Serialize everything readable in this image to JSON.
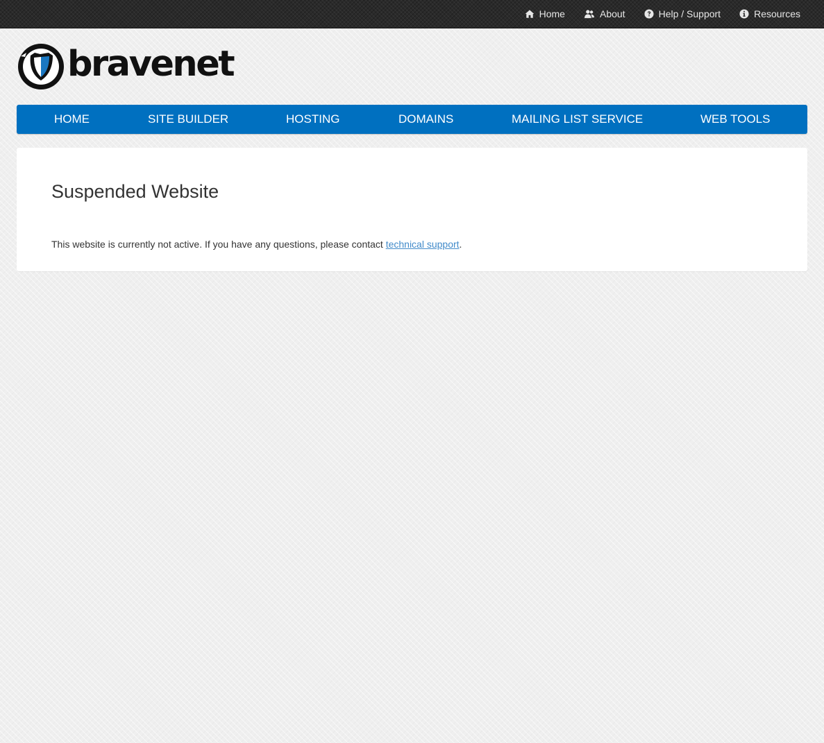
{
  "topnav": {
    "items": [
      {
        "label": "Home",
        "icon": "home-icon"
      },
      {
        "label": "About",
        "icon": "users-icon"
      },
      {
        "label": "Help / Support",
        "icon": "question-circle-icon"
      },
      {
        "label": "Resources",
        "icon": "info-circle-icon"
      }
    ]
  },
  "logo": {
    "text": "bravenet",
    "icon": "shield-logo-icon"
  },
  "mainnav": {
    "items": [
      {
        "label": "HOME"
      },
      {
        "label": "SITE BUILDER"
      },
      {
        "label": "HOSTING"
      },
      {
        "label": "DOMAINS"
      },
      {
        "label": "MAILING LIST SERVICE"
      },
      {
        "label": "WEB TOOLS"
      }
    ]
  },
  "content": {
    "title": "Suspended Website",
    "message_before": "This website is currently not active. If you have any questions, please contact ",
    "link_text": "technical support",
    "message_after": "."
  },
  "colors": {
    "nav_blue": "#0070c0",
    "topbar": "#2a2a2a",
    "link": "#428bca"
  }
}
